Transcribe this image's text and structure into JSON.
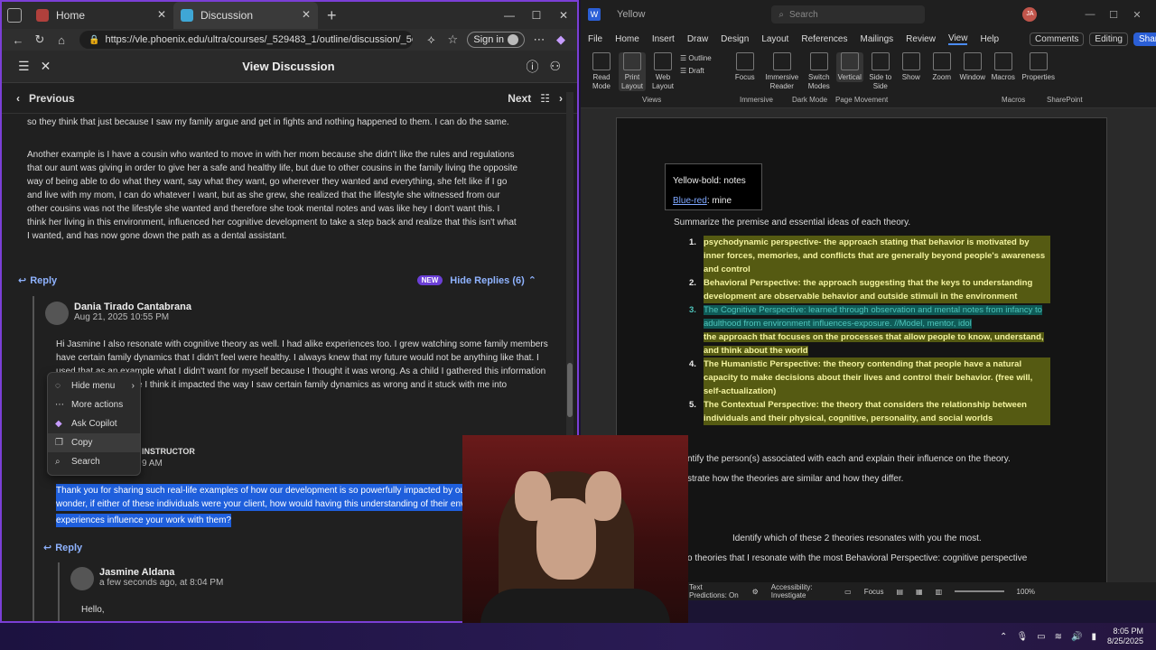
{
  "browser": {
    "tabs": [
      {
        "label": "Home",
        "active": false
      },
      {
        "label": "Discussion",
        "active": true
      }
    ],
    "url": "https://vle.phoenix.edu/ultra/courses/_529483_1/outline/discussion/_50674535_1?vi...",
    "signin_label": "Sign in",
    "view_title": "View Discussion",
    "prev_label": "Previous",
    "next_label": "Next",
    "post_text_1": "so they think that just because I saw my family argue and get in fights and nothing happened to them. I can do the same.",
    "post_text_2": "Another example is I have a cousin who wanted to move in with her mom because she didn't like the rules and regulations that our aunt was giving in order to give her a safe and healthy life, but due to other cousins in the family living the opposite way of being able to do what they want, say what they want, go wherever they wanted and everything, she felt like if I go and live with my mom, I can do whatever I want, but as she grew, she realized that the lifestyle she witnessed from our other cousins was not the lifestyle she wanted and therefore she took mental notes and was like hey I don't want this. I think her living in this environment, influenced her cognitive development to take a step back and realize that this isn't what I wanted, and has now gone down the path as a dental assistant.",
    "reply_label": "Reply",
    "new_badge": "NEW",
    "hide_replies": "Hide Replies (6)",
    "reply1": {
      "name": "Dania Tirado Cantabrana",
      "date": "Aug 21, 2025 10:55 PM",
      "line1": "Hi Jasmine I also resonate with cognitive theory as well. I had alike experiences too. I grew watching some family members",
      "line2": "have certain family dynamics that I didn't feel were healthy. I always knew that my future would not be anything like that. I",
      "line3": "used that as an example what I didn't want for myself because I thought it was wrong. As a child I gathered this information",
      "line4": "e I think it impacted the way I saw certain family dynamics as wrong and it stuck with me into"
    },
    "instructor_label": "INSTRUCTOR",
    "instructor_time": "9 AM",
    "selected_1": "Thank you for sharing such real-life examples of how our development is so powerfully impacted by our",
    "selected_2": "wonder, if either of these individuals were your client, how would having this understanding of their envi",
    "selected_3": "experiences influence your work with them?",
    "reply2": {
      "name": "Jasmine Aldana",
      "date": "a few seconds ago, at 8:04 PM",
      "body": "Hello,"
    },
    "context_menu": [
      {
        "label": "Hide menu",
        "icon": "hide-icon"
      },
      {
        "label": "More actions",
        "icon": "ellipsis-icon"
      },
      {
        "label": "Ask Copilot",
        "icon": "copilot-icon"
      },
      {
        "label": "Copy",
        "icon": "copy-icon"
      },
      {
        "label": "Search",
        "icon": "search-icon"
      }
    ]
  },
  "word": {
    "doc_name": "Yellow",
    "search_placeholder": "Search",
    "user_initials": "JA",
    "menu": [
      "File",
      "Home",
      "Insert",
      "Draw",
      "Design",
      "Layout",
      "References",
      "Mailings",
      "Review",
      "View",
      "Help"
    ],
    "comments_label": "Comments",
    "editing_label": "Editing",
    "share_label": "Share",
    "ribbon": {
      "read_mode": "Read Mode",
      "print_layout": "Print Layout",
      "web_layout": "Web Layout",
      "outline": "Outline",
      "draft": "Draft",
      "focus": "Focus",
      "immersive_reader": "Immersive Reader",
      "switch_modes": "Switch Modes",
      "vertical": "Vertical",
      "side_to_side": "Side to Side",
      "show": "Show",
      "zoom": "Zoom",
      "window": "Window",
      "macros": "Macros",
      "properties": "Properties",
      "groups": [
        "Views",
        "Immersive",
        "Dark Mode",
        "Page Movement",
        "Macros",
        "SharePoint"
      ]
    },
    "legend_line1": "Yellow-bold: notes",
    "legend_line2a": "Blue-red",
    "legend_line2b": ": mine",
    "summarize": "Summarize the premise and essential ideas of each theory.",
    "list": [
      {
        "n": "1.",
        "text": "psychodynamic perspective- the approach stating that behavior is motivated by inner forces, memories, and conflicts that are generally beyond people's awareness and control"
      },
      {
        "n": "2.",
        "text": "Behavioral Perspective: the approach suggesting that the keys to understanding development are observable behavior and outside stimuli in the environment"
      },
      {
        "n": "3.",
        "teal": "The Cognitive Perspective: learned through observation and mental notes from infancy to adulthood from environment influences-exposure. //Model, mentor, idol",
        "text": "the approach that focuses on the processes that allow people to know, understand, and think about the world"
      },
      {
        "n": "4.",
        "text": "The Humanistic Perspective: the theory contending that people have a natural capacity to make decisions about their lives and control their behavior. (free will, self-actualization)"
      },
      {
        "n": "5.",
        "text": "The Contextual Perspective: the theory that considers the relationship between individuals and their physical, cognitive, personality, and social worlds"
      }
    ],
    "identify": "ntify the person(s) associated with each and explain their influence on the theory.",
    "illustrate": "strate how the theories are similar and how they differ.",
    "identify2": "Identify which of these 2 theories resonates with you the most.",
    "resonate": "o theories that I resonate with the most Behavioral Perspective: cognitive perspective",
    "status": {
      "predictions": "Text Predictions: On",
      "accessibility": "Accessibility: Investigate",
      "focus": "Focus",
      "zoom": "100%"
    }
  },
  "taskbar": {
    "time": "8:05 PM",
    "date": "8/25/2025"
  },
  "colors": {
    "accent_purple": "#7b3fd6",
    "selection_blue": "#1f5fdc",
    "highlight_yellow_bg": "#555a12",
    "highlight_teal_bg": "#0f5b57"
  }
}
